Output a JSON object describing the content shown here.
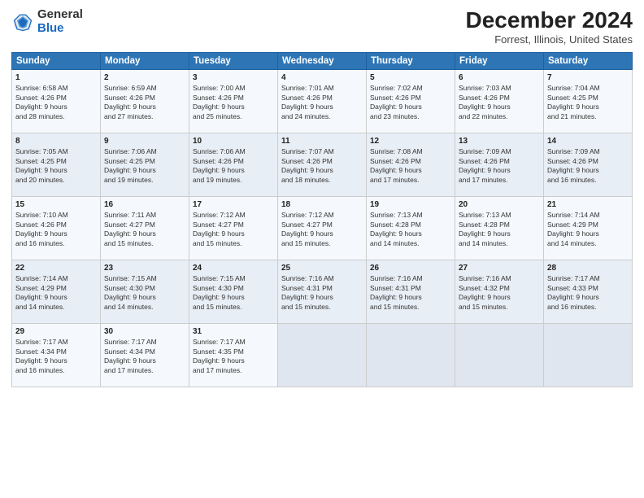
{
  "header": {
    "logo_general": "General",
    "logo_blue": "Blue",
    "month": "December 2024",
    "location": "Forrest, Illinois, United States"
  },
  "days_of_week": [
    "Sunday",
    "Monday",
    "Tuesday",
    "Wednesday",
    "Thursday",
    "Friday",
    "Saturday"
  ],
  "weeks": [
    [
      {
        "day": "1",
        "lines": [
          "Sunrise: 6:58 AM",
          "Sunset: 4:26 PM",
          "Daylight: 9 hours",
          "and 28 minutes."
        ]
      },
      {
        "day": "2",
        "lines": [
          "Sunrise: 6:59 AM",
          "Sunset: 4:26 PM",
          "Daylight: 9 hours",
          "and 27 minutes."
        ]
      },
      {
        "day": "3",
        "lines": [
          "Sunrise: 7:00 AM",
          "Sunset: 4:26 PM",
          "Daylight: 9 hours",
          "and 25 minutes."
        ]
      },
      {
        "day": "4",
        "lines": [
          "Sunrise: 7:01 AM",
          "Sunset: 4:26 PM",
          "Daylight: 9 hours",
          "and 24 minutes."
        ]
      },
      {
        "day": "5",
        "lines": [
          "Sunrise: 7:02 AM",
          "Sunset: 4:26 PM",
          "Daylight: 9 hours",
          "and 23 minutes."
        ]
      },
      {
        "day": "6",
        "lines": [
          "Sunrise: 7:03 AM",
          "Sunset: 4:26 PM",
          "Daylight: 9 hours",
          "and 22 minutes."
        ]
      },
      {
        "day": "7",
        "lines": [
          "Sunrise: 7:04 AM",
          "Sunset: 4:25 PM",
          "Daylight: 9 hours",
          "and 21 minutes."
        ]
      }
    ],
    [
      {
        "day": "8",
        "lines": [
          "Sunrise: 7:05 AM",
          "Sunset: 4:25 PM",
          "Daylight: 9 hours",
          "and 20 minutes."
        ]
      },
      {
        "day": "9",
        "lines": [
          "Sunrise: 7:06 AM",
          "Sunset: 4:25 PM",
          "Daylight: 9 hours",
          "and 19 minutes."
        ]
      },
      {
        "day": "10",
        "lines": [
          "Sunrise: 7:06 AM",
          "Sunset: 4:26 PM",
          "Daylight: 9 hours",
          "and 19 minutes."
        ]
      },
      {
        "day": "11",
        "lines": [
          "Sunrise: 7:07 AM",
          "Sunset: 4:26 PM",
          "Daylight: 9 hours",
          "and 18 minutes."
        ]
      },
      {
        "day": "12",
        "lines": [
          "Sunrise: 7:08 AM",
          "Sunset: 4:26 PM",
          "Daylight: 9 hours",
          "and 17 minutes."
        ]
      },
      {
        "day": "13",
        "lines": [
          "Sunrise: 7:09 AM",
          "Sunset: 4:26 PM",
          "Daylight: 9 hours",
          "and 17 minutes."
        ]
      },
      {
        "day": "14",
        "lines": [
          "Sunrise: 7:09 AM",
          "Sunset: 4:26 PM",
          "Daylight: 9 hours",
          "and 16 minutes."
        ]
      }
    ],
    [
      {
        "day": "15",
        "lines": [
          "Sunrise: 7:10 AM",
          "Sunset: 4:26 PM",
          "Daylight: 9 hours",
          "and 16 minutes."
        ]
      },
      {
        "day": "16",
        "lines": [
          "Sunrise: 7:11 AM",
          "Sunset: 4:27 PM",
          "Daylight: 9 hours",
          "and 15 minutes."
        ]
      },
      {
        "day": "17",
        "lines": [
          "Sunrise: 7:12 AM",
          "Sunset: 4:27 PM",
          "Daylight: 9 hours",
          "and 15 minutes."
        ]
      },
      {
        "day": "18",
        "lines": [
          "Sunrise: 7:12 AM",
          "Sunset: 4:27 PM",
          "Daylight: 9 hours",
          "and 15 minutes."
        ]
      },
      {
        "day": "19",
        "lines": [
          "Sunrise: 7:13 AM",
          "Sunset: 4:28 PM",
          "Daylight: 9 hours",
          "and 14 minutes."
        ]
      },
      {
        "day": "20",
        "lines": [
          "Sunrise: 7:13 AM",
          "Sunset: 4:28 PM",
          "Daylight: 9 hours",
          "and 14 minutes."
        ]
      },
      {
        "day": "21",
        "lines": [
          "Sunrise: 7:14 AM",
          "Sunset: 4:29 PM",
          "Daylight: 9 hours",
          "and 14 minutes."
        ]
      }
    ],
    [
      {
        "day": "22",
        "lines": [
          "Sunrise: 7:14 AM",
          "Sunset: 4:29 PM",
          "Daylight: 9 hours",
          "and 14 minutes."
        ]
      },
      {
        "day": "23",
        "lines": [
          "Sunrise: 7:15 AM",
          "Sunset: 4:30 PM",
          "Daylight: 9 hours",
          "and 14 minutes."
        ]
      },
      {
        "day": "24",
        "lines": [
          "Sunrise: 7:15 AM",
          "Sunset: 4:30 PM",
          "Daylight: 9 hours",
          "and 15 minutes."
        ]
      },
      {
        "day": "25",
        "lines": [
          "Sunrise: 7:16 AM",
          "Sunset: 4:31 PM",
          "Daylight: 9 hours",
          "and 15 minutes."
        ]
      },
      {
        "day": "26",
        "lines": [
          "Sunrise: 7:16 AM",
          "Sunset: 4:31 PM",
          "Daylight: 9 hours",
          "and 15 minutes."
        ]
      },
      {
        "day": "27",
        "lines": [
          "Sunrise: 7:16 AM",
          "Sunset: 4:32 PM",
          "Daylight: 9 hours",
          "and 15 minutes."
        ]
      },
      {
        "day": "28",
        "lines": [
          "Sunrise: 7:17 AM",
          "Sunset: 4:33 PM",
          "Daylight: 9 hours",
          "and 16 minutes."
        ]
      }
    ],
    [
      {
        "day": "29",
        "lines": [
          "Sunrise: 7:17 AM",
          "Sunset: 4:34 PM",
          "Daylight: 9 hours",
          "and 16 minutes."
        ]
      },
      {
        "day": "30",
        "lines": [
          "Sunrise: 7:17 AM",
          "Sunset: 4:34 PM",
          "Daylight: 9 hours",
          "and 17 minutes."
        ]
      },
      {
        "day": "31",
        "lines": [
          "Sunrise: 7:17 AM",
          "Sunset: 4:35 PM",
          "Daylight: 9 hours",
          "and 17 minutes."
        ]
      },
      null,
      null,
      null,
      null
    ]
  ]
}
